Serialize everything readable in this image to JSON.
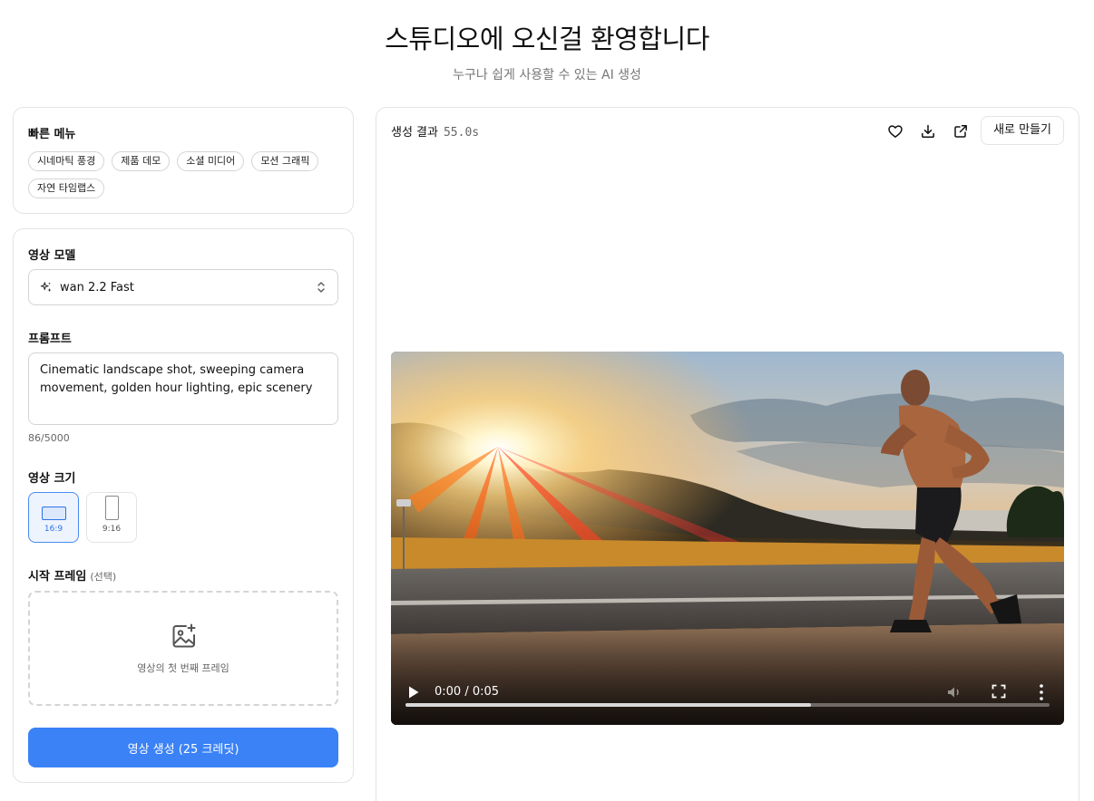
{
  "header": {
    "title": "스튜디오에 오신걸 환영합니다",
    "subtitle": "누구나 쉽게 사용할 수 있는 AI 생성"
  },
  "quick_menu": {
    "title": "빠른 메뉴",
    "chips": [
      "시네마틱 풍경",
      "제품 데모",
      "소셜 미디어",
      "모션 그래픽",
      "자연 타임랩스"
    ]
  },
  "form": {
    "model_label": "영상 모델",
    "model_value": "wan 2.2 Fast",
    "prompt_label": "프롬프트",
    "prompt_value": "Cinematic landscape shot, sweeping camera movement, golden hour lighting, epic scenery",
    "prompt_counter": "86/5000",
    "size_label": "영상 크기",
    "ratios": [
      {
        "label": "16:9",
        "selected": true
      },
      {
        "label": "9:16",
        "selected": false
      }
    ],
    "start_frame_label": "시작 프레임",
    "start_frame_optional": "(선택)",
    "start_frame_hint": "영상의 첫 번째 프레임",
    "generate_label": "영상 생성 (25 크레딧)"
  },
  "result": {
    "title": "생성 결과",
    "time": "55.0s",
    "new_label": "새로 만들기",
    "icons": [
      "heart-icon",
      "download-icon",
      "external-link-icon"
    ],
    "video": {
      "time_display": "0:00 / 0:05",
      "progress": 0.63
    }
  },
  "colors": {
    "accent": "#3b82f6",
    "border": "#e4e4e7"
  }
}
